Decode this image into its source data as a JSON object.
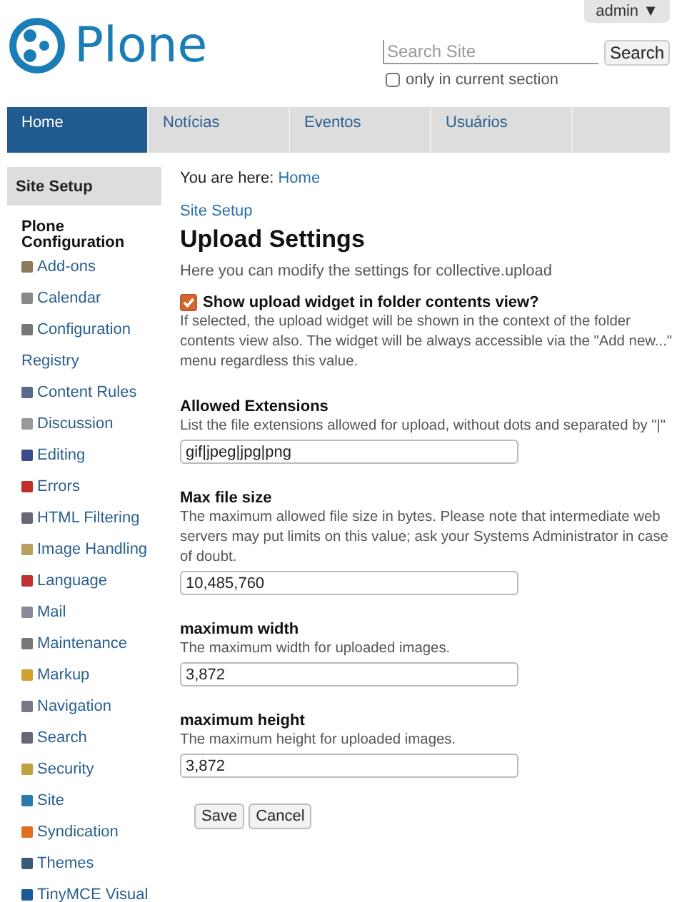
{
  "user_menu": {
    "label": "admin ▼"
  },
  "logo": {
    "text": "Plone"
  },
  "search": {
    "placeholder": "Search Site",
    "button": "Search",
    "only_current_section": {
      "label": "only in current section",
      "checked": false
    }
  },
  "tabs": [
    {
      "label": "Home",
      "selected": true
    },
    {
      "label": "Notícias",
      "selected": false
    },
    {
      "label": "Eventos",
      "selected": false
    },
    {
      "label": "Usuários",
      "selected": false
    }
  ],
  "sidebar": {
    "title": "Site Setup",
    "section": "Plone Configuration",
    "items": [
      {
        "label": "Add-ons"
      },
      {
        "label": "Calendar"
      },
      {
        "label": "Configuration Registry"
      },
      {
        "label": "Content Rules"
      },
      {
        "label": "Discussion"
      },
      {
        "label": "Editing"
      },
      {
        "label": "Errors"
      },
      {
        "label": "HTML Filtering"
      },
      {
        "label": "Image Handling"
      },
      {
        "label": "Language"
      },
      {
        "label": "Mail"
      },
      {
        "label": "Maintenance"
      },
      {
        "label": "Markup"
      },
      {
        "label": "Navigation"
      },
      {
        "label": "Search"
      },
      {
        "label": "Security"
      },
      {
        "label": "Site"
      },
      {
        "label": "Syndication"
      },
      {
        "label": "Themes"
      },
      {
        "label": "TinyMCE Visual"
      }
    ]
  },
  "breadcrumb": {
    "prefix": "You are here:",
    "link": "Home"
  },
  "back_link": "Site Setup",
  "title": "Upload Settings",
  "description": "Here you can modify the settings for collective.upload",
  "fields": [
    {
      "kind": "checkbox",
      "label": "Show upload widget in folder contents view?",
      "checked": true,
      "help": "If selected, the upload widget will be shown in the context of the folder contents view also. The widget will be always accessible via the \"Add new...\" menu regardless this value."
    },
    {
      "kind": "text",
      "label": "Allowed Extensions",
      "help": "List the file extensions allowed for upload, without dots and separated by \"|\"",
      "value": "gif|jpeg|jpg|png"
    },
    {
      "kind": "text",
      "label": "Max file size",
      "help": "The maximum allowed file size in bytes. Please note that intermediate web servers may put limits on this value; ask your Systems Administrator in case of doubt.",
      "value": "10,485,760"
    },
    {
      "kind": "text",
      "label": "maximum width",
      "help": "The maximum width for uploaded images.",
      "value": "3,872"
    },
    {
      "kind": "text",
      "label": "maximum height",
      "help": "The maximum height for uploaded images.",
      "value": "3,872"
    }
  ],
  "buttons": [
    "Save",
    "Cancel"
  ]
}
